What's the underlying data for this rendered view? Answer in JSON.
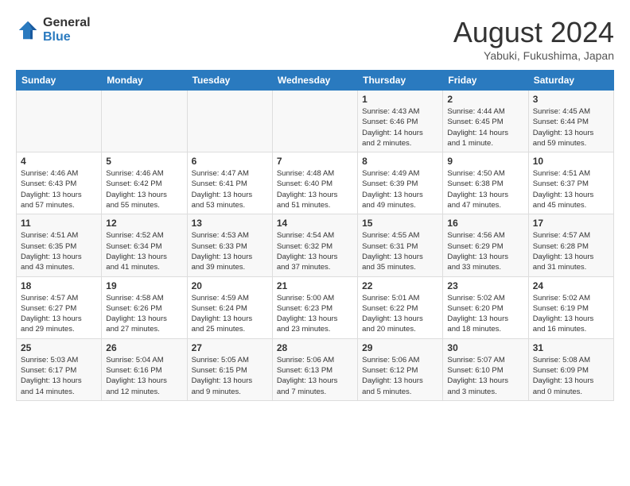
{
  "header": {
    "logo_general": "General",
    "logo_blue": "Blue",
    "month_title": "August 2024",
    "subtitle": "Yabuki, Fukushima, Japan"
  },
  "weekdays": [
    "Sunday",
    "Monday",
    "Tuesday",
    "Wednesday",
    "Thursday",
    "Friday",
    "Saturday"
  ],
  "weeks": [
    [
      {
        "day": "",
        "info": ""
      },
      {
        "day": "",
        "info": ""
      },
      {
        "day": "",
        "info": ""
      },
      {
        "day": "",
        "info": ""
      },
      {
        "day": "1",
        "info": "Sunrise: 4:43 AM\nSunset: 6:46 PM\nDaylight: 14 hours\nand 2 minutes."
      },
      {
        "day": "2",
        "info": "Sunrise: 4:44 AM\nSunset: 6:45 PM\nDaylight: 14 hours\nand 1 minute."
      },
      {
        "day": "3",
        "info": "Sunrise: 4:45 AM\nSunset: 6:44 PM\nDaylight: 13 hours\nand 59 minutes."
      }
    ],
    [
      {
        "day": "4",
        "info": "Sunrise: 4:46 AM\nSunset: 6:43 PM\nDaylight: 13 hours\nand 57 minutes."
      },
      {
        "day": "5",
        "info": "Sunrise: 4:46 AM\nSunset: 6:42 PM\nDaylight: 13 hours\nand 55 minutes."
      },
      {
        "day": "6",
        "info": "Sunrise: 4:47 AM\nSunset: 6:41 PM\nDaylight: 13 hours\nand 53 minutes."
      },
      {
        "day": "7",
        "info": "Sunrise: 4:48 AM\nSunset: 6:40 PM\nDaylight: 13 hours\nand 51 minutes."
      },
      {
        "day": "8",
        "info": "Sunrise: 4:49 AM\nSunset: 6:39 PM\nDaylight: 13 hours\nand 49 minutes."
      },
      {
        "day": "9",
        "info": "Sunrise: 4:50 AM\nSunset: 6:38 PM\nDaylight: 13 hours\nand 47 minutes."
      },
      {
        "day": "10",
        "info": "Sunrise: 4:51 AM\nSunset: 6:37 PM\nDaylight: 13 hours\nand 45 minutes."
      }
    ],
    [
      {
        "day": "11",
        "info": "Sunrise: 4:51 AM\nSunset: 6:35 PM\nDaylight: 13 hours\nand 43 minutes."
      },
      {
        "day": "12",
        "info": "Sunrise: 4:52 AM\nSunset: 6:34 PM\nDaylight: 13 hours\nand 41 minutes."
      },
      {
        "day": "13",
        "info": "Sunrise: 4:53 AM\nSunset: 6:33 PM\nDaylight: 13 hours\nand 39 minutes."
      },
      {
        "day": "14",
        "info": "Sunrise: 4:54 AM\nSunset: 6:32 PM\nDaylight: 13 hours\nand 37 minutes."
      },
      {
        "day": "15",
        "info": "Sunrise: 4:55 AM\nSunset: 6:31 PM\nDaylight: 13 hours\nand 35 minutes."
      },
      {
        "day": "16",
        "info": "Sunrise: 4:56 AM\nSunset: 6:29 PM\nDaylight: 13 hours\nand 33 minutes."
      },
      {
        "day": "17",
        "info": "Sunrise: 4:57 AM\nSunset: 6:28 PM\nDaylight: 13 hours\nand 31 minutes."
      }
    ],
    [
      {
        "day": "18",
        "info": "Sunrise: 4:57 AM\nSunset: 6:27 PM\nDaylight: 13 hours\nand 29 minutes."
      },
      {
        "day": "19",
        "info": "Sunrise: 4:58 AM\nSunset: 6:26 PM\nDaylight: 13 hours\nand 27 minutes."
      },
      {
        "day": "20",
        "info": "Sunrise: 4:59 AM\nSunset: 6:24 PM\nDaylight: 13 hours\nand 25 minutes."
      },
      {
        "day": "21",
        "info": "Sunrise: 5:00 AM\nSunset: 6:23 PM\nDaylight: 13 hours\nand 23 minutes."
      },
      {
        "day": "22",
        "info": "Sunrise: 5:01 AM\nSunset: 6:22 PM\nDaylight: 13 hours\nand 20 minutes."
      },
      {
        "day": "23",
        "info": "Sunrise: 5:02 AM\nSunset: 6:20 PM\nDaylight: 13 hours\nand 18 minutes."
      },
      {
        "day": "24",
        "info": "Sunrise: 5:02 AM\nSunset: 6:19 PM\nDaylight: 13 hours\nand 16 minutes."
      }
    ],
    [
      {
        "day": "25",
        "info": "Sunrise: 5:03 AM\nSunset: 6:17 PM\nDaylight: 13 hours\nand 14 minutes."
      },
      {
        "day": "26",
        "info": "Sunrise: 5:04 AM\nSunset: 6:16 PM\nDaylight: 13 hours\nand 12 minutes."
      },
      {
        "day": "27",
        "info": "Sunrise: 5:05 AM\nSunset: 6:15 PM\nDaylight: 13 hours\nand 9 minutes."
      },
      {
        "day": "28",
        "info": "Sunrise: 5:06 AM\nSunset: 6:13 PM\nDaylight: 13 hours\nand 7 minutes."
      },
      {
        "day": "29",
        "info": "Sunrise: 5:06 AM\nSunset: 6:12 PM\nDaylight: 13 hours\nand 5 minutes."
      },
      {
        "day": "30",
        "info": "Sunrise: 5:07 AM\nSunset: 6:10 PM\nDaylight: 13 hours\nand 3 minutes."
      },
      {
        "day": "31",
        "info": "Sunrise: 5:08 AM\nSunset: 6:09 PM\nDaylight: 13 hours\nand 0 minutes."
      }
    ]
  ]
}
